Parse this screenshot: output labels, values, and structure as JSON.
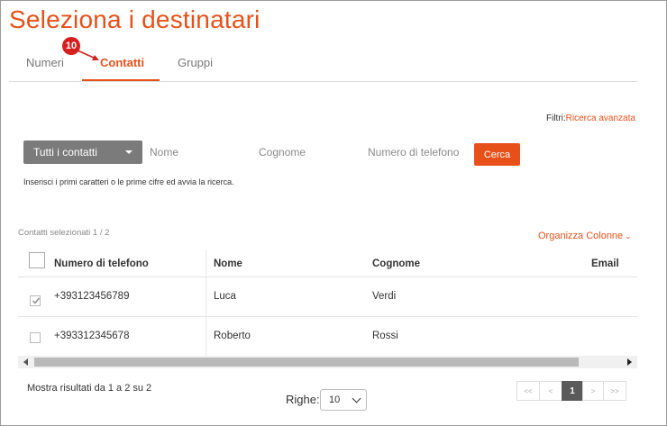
{
  "page": {
    "title": "Seleziona i destinatari"
  },
  "tabs": [
    {
      "label": "Numeri"
    },
    {
      "label": "Contatti"
    },
    {
      "label": "Gruppi"
    }
  ],
  "step_badge": "10",
  "filters": {
    "label": "Filtri:",
    "advanced_link": "Ricerca avanzata"
  },
  "search": {
    "dropdown_label": "Tutti i contatti",
    "name_placeholder": "Nome",
    "surname_placeholder": "Cognome",
    "phone_placeholder": "Numero di telefono",
    "button_label": "Cerca",
    "hint": "Inserisci i primi caratteri o le prime cifre ed avvia la ricerca."
  },
  "selection": {
    "count_text": "Contatti selezionati 1 / 2"
  },
  "organize_columns": "Organizza Colonne",
  "table": {
    "headers": [
      "Numero di telefono",
      "Nome",
      "Cognome",
      "Email"
    ],
    "rows": [
      {
        "checked": true,
        "phone": "+393123456789",
        "name": "Luca",
        "surname": "Verdi",
        "email": ""
      },
      {
        "checked": false,
        "phone": "+393312345678",
        "name": "Roberto",
        "surname": "Rossi",
        "email": ""
      }
    ]
  },
  "footer": {
    "results_text": "Mostra risultati da 1 a 2 su 2",
    "rows_label": "Righe:",
    "rows_value": "10"
  },
  "pagination": {
    "first": "<<",
    "prev": "<",
    "current": "1",
    "next": ">",
    "last": ">>"
  },
  "colors": {
    "accent": "#e8501a",
    "dropdown_bg": "#7b7b7b",
    "badge": "#d61f1f"
  }
}
